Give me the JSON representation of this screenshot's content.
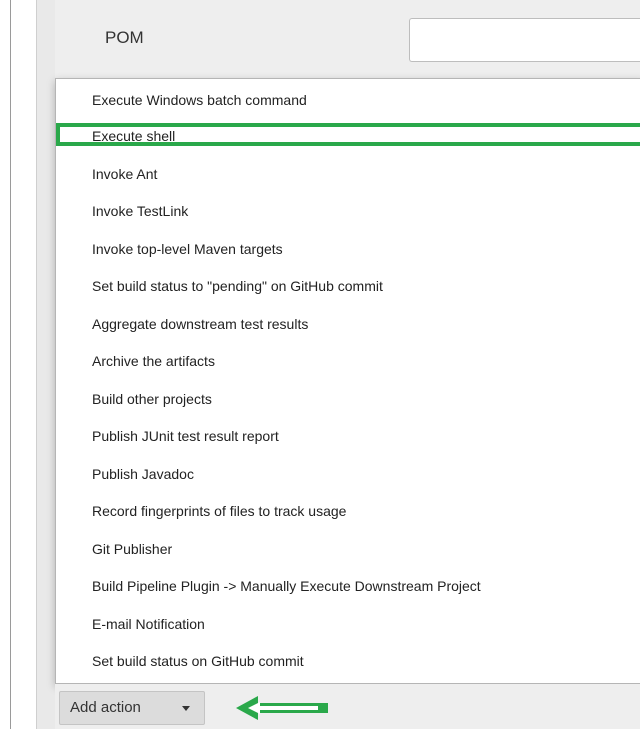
{
  "header": {
    "pom_label": "POM",
    "pom_value": ""
  },
  "menu": {
    "items": [
      "Execute Windows batch command",
      "Execute shell",
      "Invoke Ant",
      "Invoke TestLink",
      "Invoke top-level Maven targets",
      "Set build status to \"pending\" on GitHub commit",
      "Aggregate downstream test results",
      "Archive the artifacts",
      "Build other projects",
      "Publish JUnit test result report",
      "Publish Javadoc",
      "Record fingerprints of files to track usage",
      "Git Publisher",
      "Build Pipeline Plugin -> Manually Execute Downstream Project",
      "E-mail Notification",
      "Set build status on GitHub commit"
    ],
    "highlighted_item": "Execute shell"
  },
  "footer": {
    "add_action_label": "Add action",
    "caret_icon": "chevron-down-icon"
  },
  "colors": {
    "annotation_green": "#2aa84a",
    "panel_gray": "#eeeeee",
    "button_gray": "#dcdcdc"
  }
}
